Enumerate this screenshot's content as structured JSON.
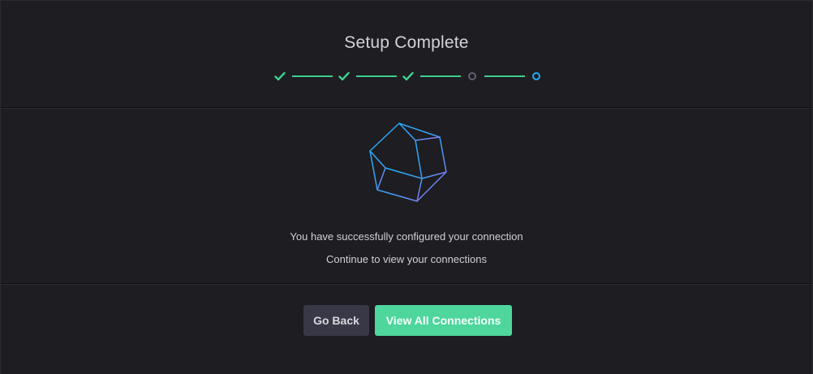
{
  "header": {
    "title": "Setup Complete"
  },
  "steps": [
    {
      "state": "complete",
      "icon": "check-icon"
    },
    {
      "state": "complete",
      "icon": "check-icon"
    },
    {
      "state": "complete",
      "icon": "check-icon"
    },
    {
      "state": "pending",
      "icon": "circle-icon"
    },
    {
      "state": "current",
      "icon": "circle-icon"
    }
  ],
  "body": {
    "graphic_icon": "crystal-icon",
    "message": "You have successfully configured your connection",
    "submessage": "Continue to view your connections"
  },
  "footer": {
    "back_label": "Go Back",
    "view_label": "View All Connections"
  },
  "colors": {
    "success": "#3fcf8e",
    "pending": "#61616e",
    "current": "#22adf6",
    "primary_button": "#4ed69c",
    "secondary_button": "#383846"
  }
}
